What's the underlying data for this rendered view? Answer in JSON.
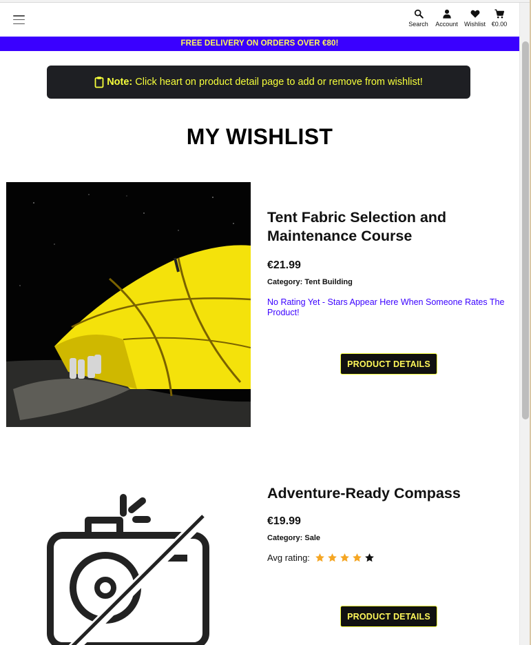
{
  "header": {
    "menu_icon": "hamburger-icon",
    "nav": [
      {
        "label": "Search",
        "icon": "search-icon"
      },
      {
        "label": "Account",
        "icon": "user-icon"
      },
      {
        "label": "Wishlist",
        "icon": "heart-icon"
      },
      {
        "label": "€0.00",
        "icon": "cart-icon"
      }
    ]
  },
  "banner": {
    "text": "FREE DELIVERY ON ORDERS OVER €80!"
  },
  "note": {
    "bold": "Note:",
    "text": " Click heart on product detail page to add or remove from wishlist!",
    "icon": "clipboard-icon"
  },
  "page": {
    "title": "MY WISHLIST"
  },
  "products": [
    {
      "name": "Tent Fabric Selection and Maintenance Course",
      "price": "€21.99",
      "category_label": "Category:",
      "category": "Tent Building",
      "rating_text": "No Rating Yet - Stars Appear Here When Someone Rates The Product!",
      "button": "PRODUCT DETAILS"
    },
    {
      "name": "Adventure-Ready Compass",
      "price": "€19.99",
      "category_label": "Category:",
      "category": "Sale",
      "rating_label": "Avg rating:",
      "rating": 4,
      "rating_max": 5,
      "button": "PRODUCT DETAILS",
      "image_icon": "no-image-camera-icon"
    }
  ],
  "colors": {
    "accent_blue": "#3a00ff",
    "accent_yellow": "#fff85a",
    "star_orange": "#f5a623",
    "dark": "#1e1f23"
  }
}
